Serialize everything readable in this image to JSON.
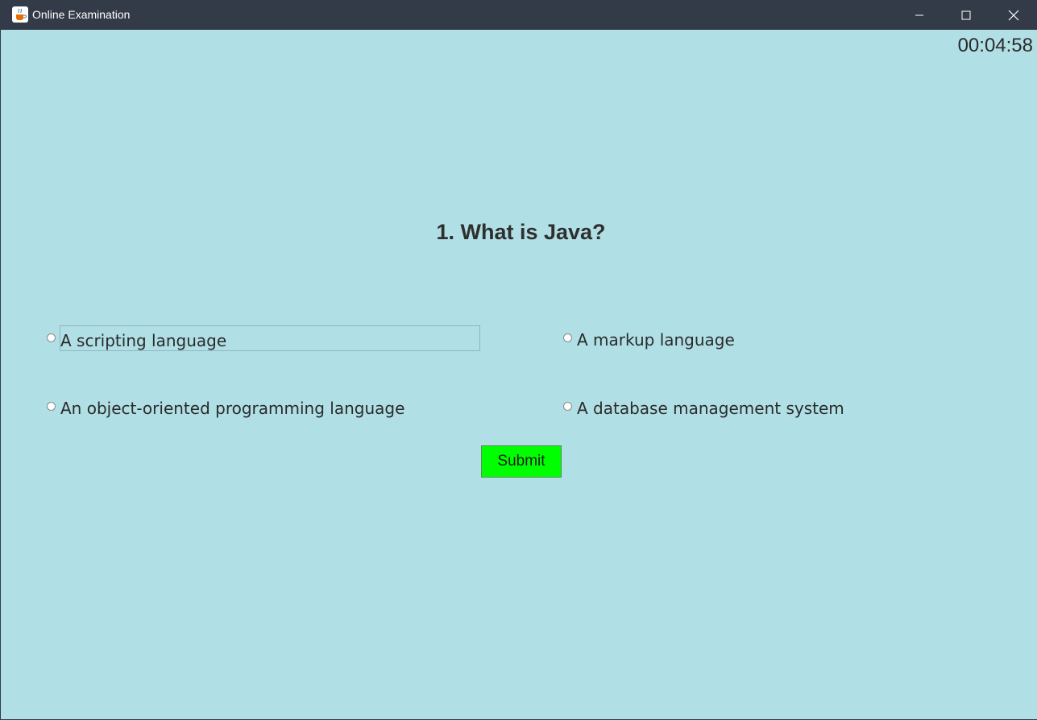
{
  "window": {
    "title": "Online Examination",
    "icons": {
      "app": "java-cup-icon",
      "minimize": "minimize-icon",
      "maximize": "maximize-icon",
      "close": "close-icon"
    }
  },
  "exam": {
    "timer": "00:04:58",
    "question": "1. What is Java?",
    "options": [
      {
        "label": "A scripting language",
        "selected": false
      },
      {
        "label": "A markup language",
        "selected": false
      },
      {
        "label": "An object-oriented programming language",
        "selected": false
      },
      {
        "label": "A database management system",
        "selected": false
      }
    ],
    "submit_label": "Submit"
  },
  "colors": {
    "titlebar": "#343b48",
    "background": "#b0dfe5",
    "submit": "#00ff00"
  }
}
